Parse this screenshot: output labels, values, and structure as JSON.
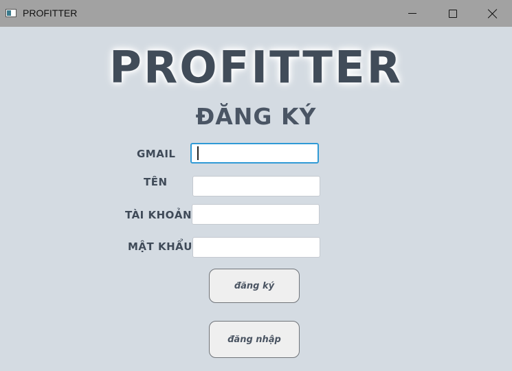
{
  "window": {
    "title": "PROFITTER"
  },
  "header": {
    "app_name": "PROFITTER",
    "form_title": "ĐĂNG KÝ"
  },
  "form": {
    "gmail_label": "GMAIL",
    "name_label": "TÊN",
    "account_label": "TÀI KHOẢN",
    "password_label": "MẬT KHẨU",
    "gmail_value": "",
    "name_value": "",
    "account_value": "",
    "password_value": ""
  },
  "buttons": {
    "register_label": "đăng ký",
    "login_label": "đăng nhập"
  },
  "colors": {
    "background": "#d4dbe2",
    "titlebar": "#a2a2a2",
    "text": "#414c59",
    "focus": "#2f9ad6"
  },
  "icons": {
    "app": "app-window-icon",
    "minimize": "minimize-icon",
    "maximize": "maximize-icon",
    "close": "close-icon"
  }
}
